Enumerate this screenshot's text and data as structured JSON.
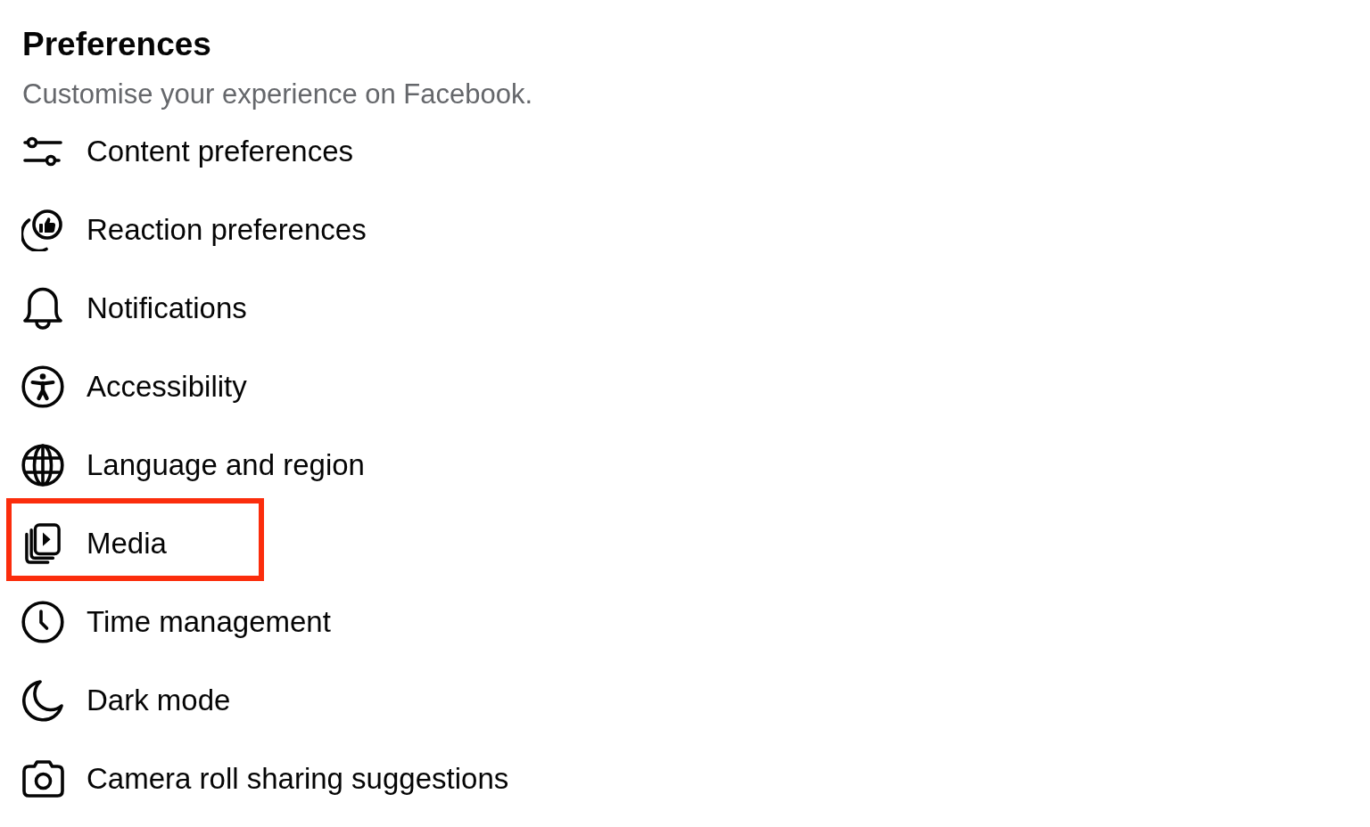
{
  "header": {
    "title": "Preferences",
    "subtitle": "Customise your experience on Facebook."
  },
  "items": [
    {
      "label": "Content preferences",
      "highlighted": false
    },
    {
      "label": "Reaction preferences",
      "highlighted": false
    },
    {
      "label": "Notifications",
      "highlighted": false
    },
    {
      "label": "Accessibility",
      "highlighted": false
    },
    {
      "label": "Language and region",
      "highlighted": false
    },
    {
      "label": "Media",
      "highlighted": true
    },
    {
      "label": "Time management",
      "highlighted": false
    },
    {
      "label": "Dark mode",
      "highlighted": false
    },
    {
      "label": "Camera roll sharing suggestions",
      "highlighted": false
    }
  ]
}
